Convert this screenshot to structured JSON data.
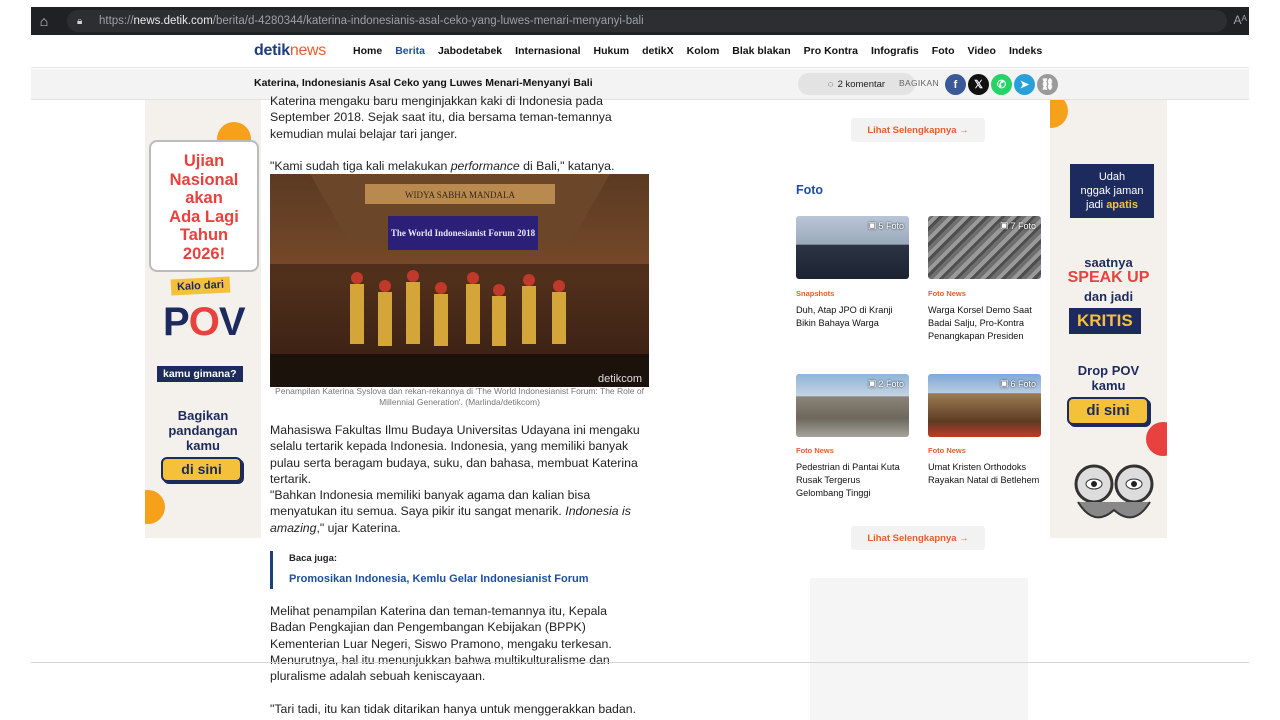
{
  "browser": {
    "url_prefix": "https://",
    "url_host": "news.detik.com",
    "url_path": "/berita/d-4280344/katerina-indonesianis-asal-ceko-yang-luwes-menari-menyanyi-bali",
    "home_icon": "home-icon",
    "reader_label": "Aᴬ"
  },
  "nav": {
    "logo_part1": "detik",
    "logo_part2": "news",
    "items": [
      "Home",
      "Berita",
      "Jabodetabek",
      "Internasional",
      "Hukum",
      "detikX",
      "Kolom",
      "Blak blakan",
      "Pro Kontra",
      "Infografis",
      "Foto",
      "Video",
      "Indeks"
    ],
    "active": "Berita"
  },
  "sticky": {
    "title": "Katerina, Indonesianis Asal Ceko yang Luwes Menari-Menyanyi Bali",
    "komentar": "2 komentar",
    "bagikan": "BAGIKAN",
    "share_icons": [
      "facebook-icon",
      "x-icon",
      "whatsapp-icon",
      "telegram-icon",
      "link-icon"
    ],
    "share_glyphs": [
      "f",
      "𝕏",
      "✆",
      "➤",
      "⛓"
    ]
  },
  "article": {
    "p1": "Katerina mengaku baru menginjakkan kaki di Indonesia pada September 2018. Sejak saat itu, dia bersama teman-temannya kemudian mulai belajar tari janger.",
    "p2_before": "\"Kami sudah tiga kali melakukan ",
    "p2_em": "performance",
    "p2_after": " di Bali,\" katanya.",
    "photo_banner": "The World Indonesianist Forum 2018",
    "photo_sign": "WIDYA SABHA MANDALA",
    "photo_watermark": "detikcom",
    "caption": "Penampilan Katerina Syslova dan rekan-rekannya di 'The World Indonesianist Forum: The Role of Millennial Generation'. (Marlinda/detikcom)",
    "p3": "Mahasiswa Fakultas Ilmu Budaya Universitas Udayana ini mengaku selalu tertarik kepada Indonesia. Indonesia, yang memiliki banyak pulau serta beragam budaya, suku, dan bahasa, membuat Katerina tertarik.",
    "p4_before": "\"Bahkan Indonesia memiliki banyak agama dan kalian bisa menyatukan itu semua. Saya pikir itu sangat menarik. ",
    "p4_em": "Indonesia is amazing",
    "p4_after": ",\" ujar Katerina.",
    "baca_label": "Baca juga:",
    "baca_link": "Promosikan Indonesia, Kemlu Gelar Indonesianist Forum",
    "p5": "Melihat penampilan Katerina dan teman-temannya itu, Kepala Badan Pengkajian dan Pengembangan Kebijakan (BPPK) Kementerian Luar Negeri, Siswo Pramono, mengaku terkesan. Menurutnya, hal itu menunjukkan bahwa multikulturalisme dan pluralisme adalah sebuah keniscayaan.",
    "p6": "\"Tari tadi, itu kan tidak ditarikan hanya untuk menggerakkan badan."
  },
  "sidebar": {
    "more_label": "Lihat Selengkapnya",
    "foto_heading": "Foto",
    "cards": [
      {
        "count": "5 Foto",
        "category": "Snapshots",
        "title": "Duh, Atap JPO di Kranji Bikin Bahaya Warga"
      },
      {
        "count": "7 Foto",
        "category": "Foto News",
        "title": "Warga Korsel Demo Saat Badai Salju, Pro-Kontra Penangkapan Presiden"
      },
      {
        "count": "2 Foto",
        "category": "Foto News",
        "title": "Pedestrian di Pantai Kuta Rusak Tergerus Gelombang Tinggi"
      },
      {
        "count": "6 Foto",
        "category": "Foto News",
        "title": "Umat Kristen Orthodoks Rayakan Natal di Betlehem"
      }
    ]
  },
  "ad_left": {
    "headline": [
      "Ujian",
      "Nasional",
      "akan",
      "Ada Lagi",
      "Tahun",
      "2026!"
    ],
    "kalo": "Kalo dari",
    "pov_p": "P",
    "pov_o": "O",
    "pov_v": "V",
    "kamu": "kamu gimana?",
    "bagikan": [
      "Bagikan",
      "pandangan",
      "kamu"
    ],
    "cta": "di sini"
  },
  "ad_right": {
    "udah": [
      "Udah",
      "nggak jaman",
      "jadi"
    ],
    "apatis": "apatis",
    "saatnya": "saatnya",
    "speak": "SPEAK UP",
    "danjadi": "dan jadi",
    "kritis": "KRITIS",
    "drop": [
      "Drop POV",
      "kamu"
    ],
    "cta": "di sini"
  },
  "colors": {
    "brand_blue": "#1d3f7e",
    "brand_orange": "#e95d2c",
    "link_blue": "#1d4e9e"
  }
}
